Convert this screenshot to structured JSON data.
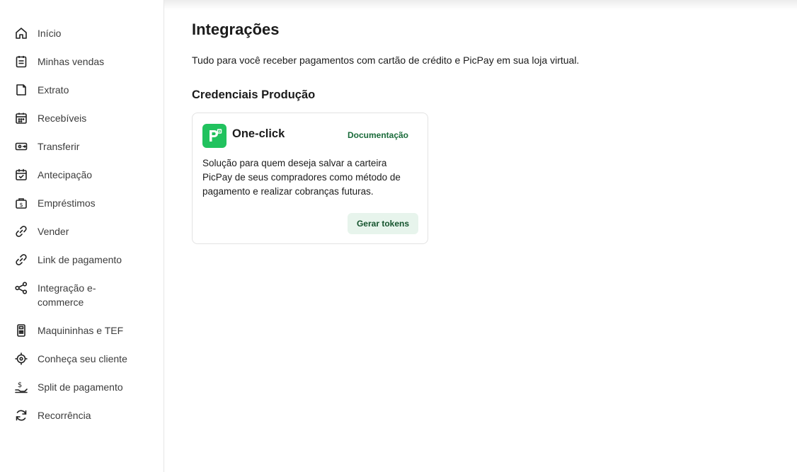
{
  "sidebar": {
    "items": [
      {
        "label": "Início",
        "icon": "home-icon"
      },
      {
        "label": "Minhas vendas",
        "icon": "receipt-icon"
      },
      {
        "label": "Extrato",
        "icon": "statement-icon"
      },
      {
        "label": "Recebíveis",
        "icon": "calendar-icon"
      },
      {
        "label": "Transferir",
        "icon": "transfer-icon"
      },
      {
        "label": "Antecipação",
        "icon": "calendar-check-icon"
      },
      {
        "label": "Empréstimos",
        "icon": "money-bag-icon"
      },
      {
        "label": "Vender",
        "icon": "link-icon"
      },
      {
        "label": "Link de pagamento",
        "icon": "link-icon"
      },
      {
        "label": "Integração e-commerce",
        "icon": "share-icon"
      },
      {
        "label": "Maquininhas e TEF",
        "icon": "card-machine-icon"
      },
      {
        "label": "Conheça seu cliente",
        "icon": "target-icon"
      },
      {
        "label": "Split de pagamento",
        "icon": "hand-money-icon"
      },
      {
        "label": "Recorrência",
        "icon": "refresh-icon"
      }
    ]
  },
  "main": {
    "title": "Integrações",
    "description": "Tudo para você receber pagamentos com cartão de crédito e PicPay em sua loja virtual.",
    "section_title": "Credenciais Produção",
    "card": {
      "logo": "picpay-logo-icon",
      "title": "One-click",
      "doc_link": "Documentação",
      "text": "Solução para quem deseja salvar a carteira PicPay de seus compradores como método de pagamento e realizar cobranças futuras.",
      "button_label": "Gerar tokens"
    }
  },
  "colors": {
    "brand_green": "#21c25e",
    "link_green": "#1a6b3a",
    "button_bg": "#e7f4ec"
  }
}
